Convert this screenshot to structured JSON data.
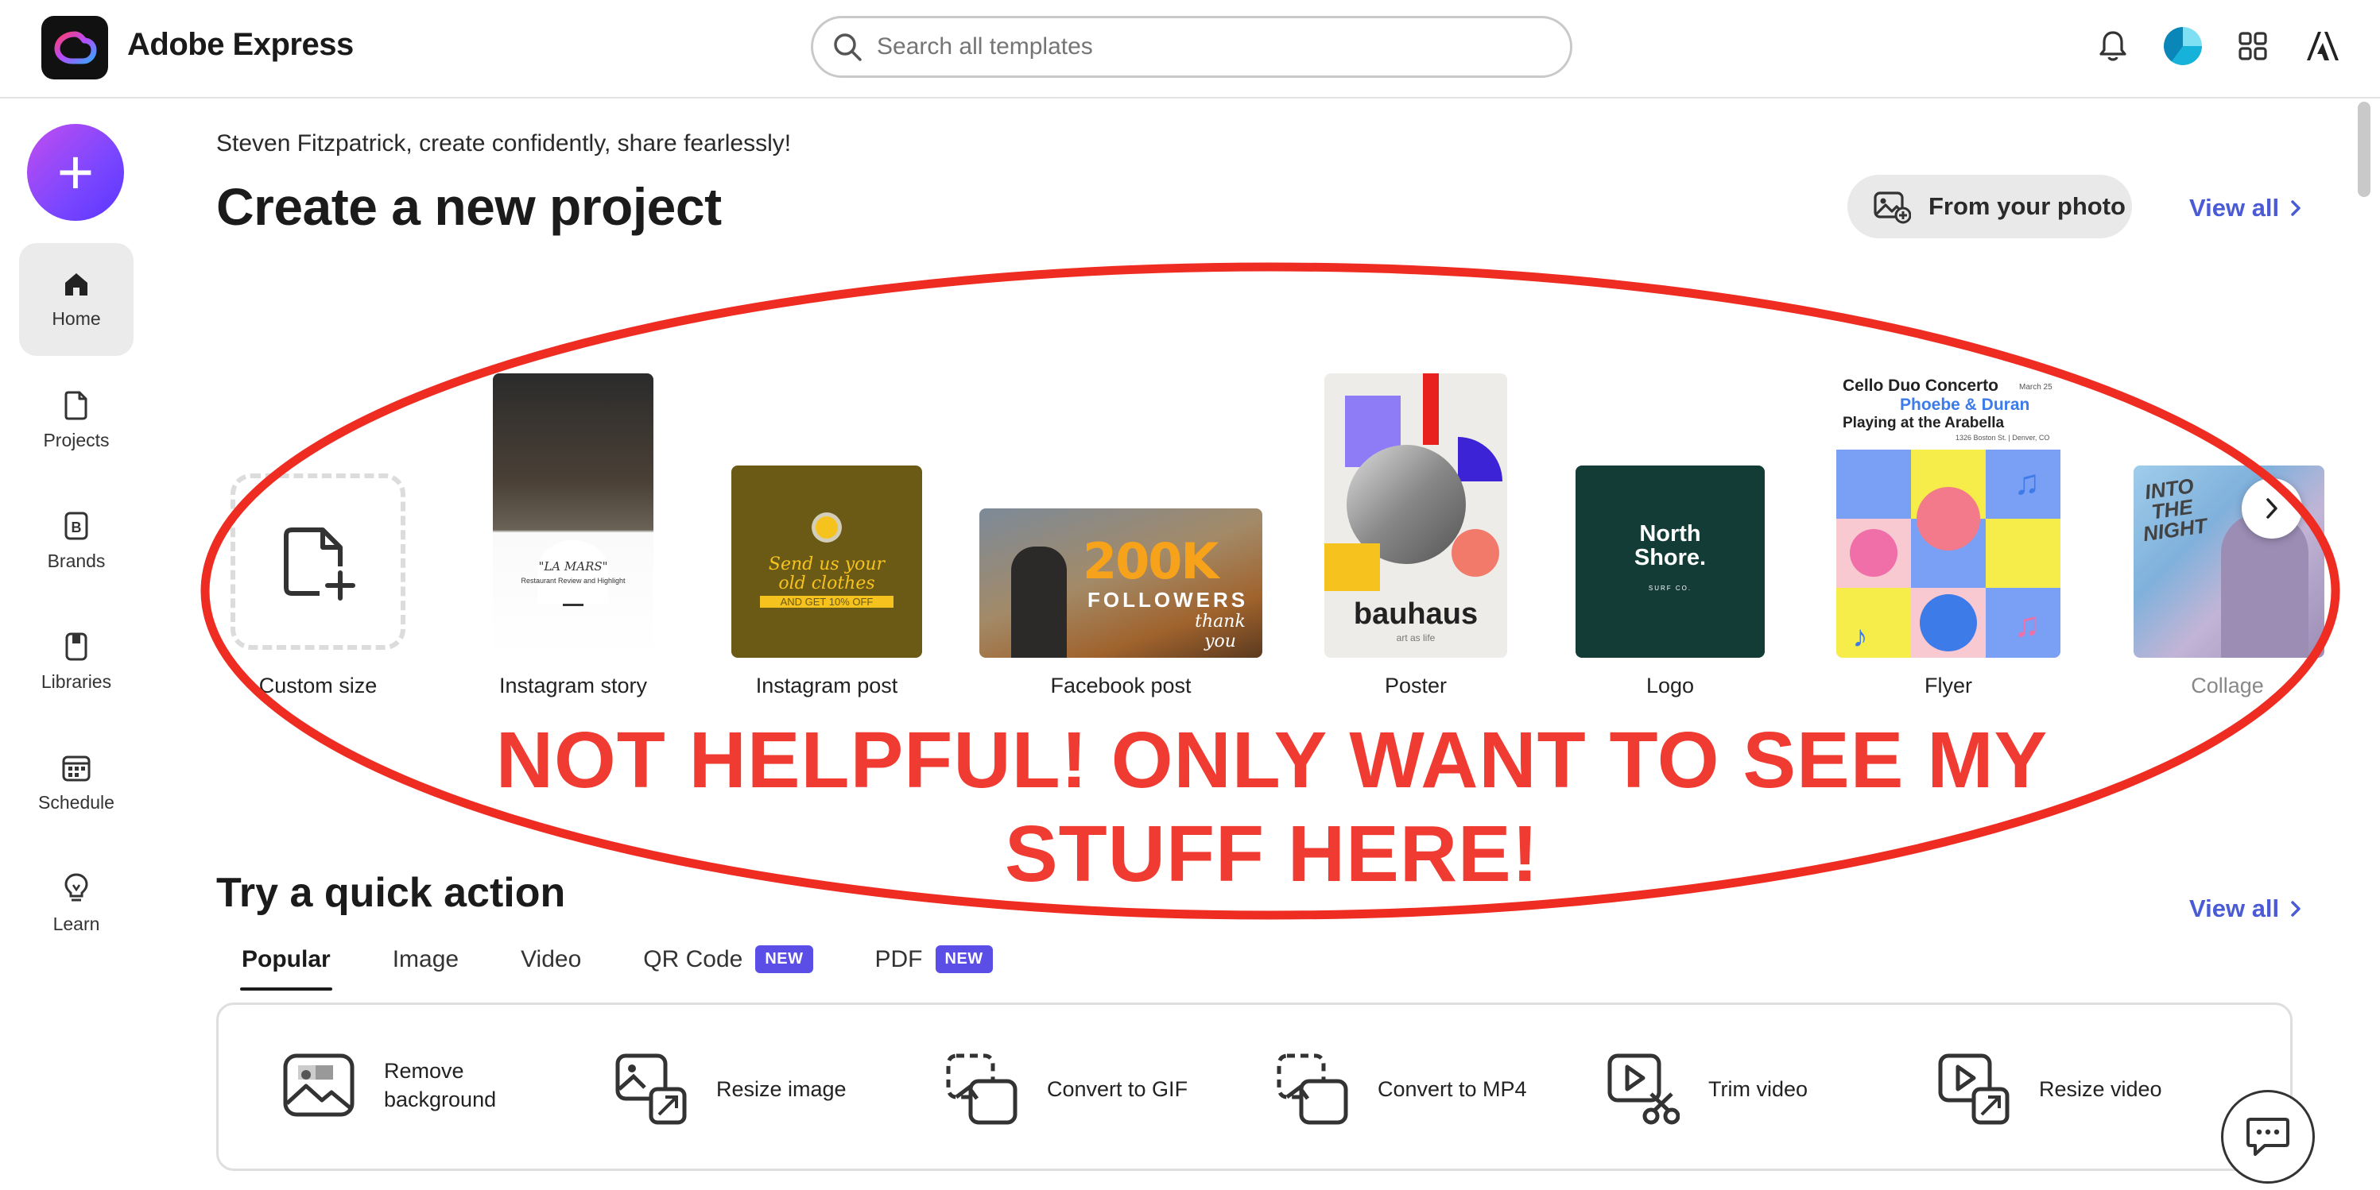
{
  "app": {
    "title": "Adobe Express",
    "logo_icon": "creative-cloud-icon"
  },
  "search": {
    "placeholder": "Search all templates"
  },
  "header_icons": [
    "bell-icon",
    "avatar",
    "apps-grid-icon",
    "adobe-icon"
  ],
  "sidebar": {
    "create_button_icon": "plus-icon",
    "items": [
      {
        "label": "Home",
        "icon": "home-icon",
        "active": true
      },
      {
        "label": "Projects",
        "icon": "file-icon"
      },
      {
        "label": "Brands",
        "icon": "brand-icon"
      },
      {
        "label": "Libraries",
        "icon": "library-icon"
      },
      {
        "label": "Schedule",
        "icon": "calendar-icon"
      },
      {
        "label": "Learn",
        "icon": "bulb-icon"
      }
    ]
  },
  "main": {
    "greeting": "Steven Fitzpatrick, create confidently, share fearlessly!",
    "heading": "Create a new project",
    "from_photo_label": "From your photo",
    "view_all_label": "View all",
    "templates": [
      {
        "label": "Custom size"
      },
      {
        "label": "Instagram story",
        "thumb_text": [
          "\"LA MARS\"",
          "Restaurant Review and Highlight"
        ]
      },
      {
        "label": "Instagram post",
        "thumb_text": [
          "Send us your",
          "old clothes",
          "AND GET 10% OFF"
        ]
      },
      {
        "label": "Facebook post",
        "thumb_text": [
          "200K",
          "FOLLOWERS",
          "thank you"
        ]
      },
      {
        "label": "Poster",
        "thumb_text": [
          "bauhaus",
          "art as life"
        ]
      },
      {
        "label": "Logo",
        "thumb_text": [
          "North",
          "Shore.",
          "SURF CO."
        ]
      },
      {
        "label": "Flyer",
        "thumb_text": [
          "Cello Duo Concerto",
          "March 25",
          "Phoebe & Duran",
          "Playing at the Arabella",
          "1326 Boston St. | Denver, CO"
        ]
      },
      {
        "label": "Collage",
        "thumb_text": [
          "INTO",
          "THE",
          "NIGHT"
        ]
      }
    ],
    "annotation": {
      "text": "NOT HELPFUL! ONLY WANT TO SEE MY STUFF HERE!",
      "color": "#ef3b32"
    }
  },
  "quick_actions": {
    "heading": "Try a quick action",
    "view_all_label": "View all",
    "tabs": [
      {
        "label": "Popular",
        "active": true
      },
      {
        "label": "Image"
      },
      {
        "label": "Video"
      },
      {
        "label": "QR Code",
        "badge": "NEW"
      },
      {
        "label": "PDF",
        "badge": "NEW"
      }
    ],
    "actions": [
      {
        "label": "Remove background",
        "icon": "remove-background-icon"
      },
      {
        "label": "Resize image",
        "icon": "resize-image-icon"
      },
      {
        "label": "Convert to GIF",
        "icon": "convert-gif-icon"
      },
      {
        "label": "Convert to MP4",
        "icon": "convert-mp4-icon"
      },
      {
        "label": "Trim video",
        "icon": "trim-video-icon"
      },
      {
        "label": "Resize video",
        "icon": "resize-video-icon"
      }
    ]
  },
  "colors": {
    "accent_link": "#4b5bd6",
    "badge": "#5b4ee6",
    "annotation_red": "#ef3b32"
  }
}
